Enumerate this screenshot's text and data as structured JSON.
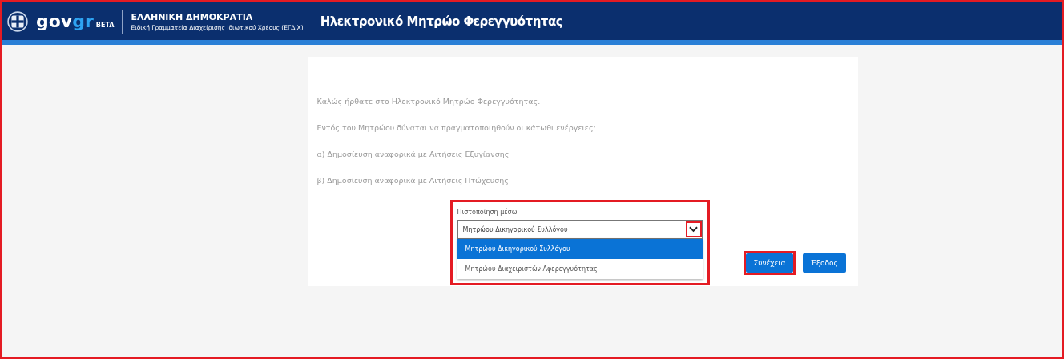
{
  "window": {
    "highlighted": true
  },
  "header": {
    "logo": "gov",
    "logo_accent": "gr",
    "logo_badge": "BETA",
    "org_title": "ΕΛΛΗΝΙΚΗ ΔΗΜΟΚΡΑΤΙΑ",
    "org_subtitle": "Ειδική Γραμματεία Διαχείρισης Ιδιωτικού Χρέους (ΕΓΔΙΧ)",
    "app_title": "Ηλεκτρονικό Μητρώο Φερεγγυότητας"
  },
  "intro": [
    "Καλώς ήρθατε στο Ηλεκτρονικό Μητρώο Φερεγγυότητας.",
    "Εντός του Μητρώου δύναται να πραγματοποιηθούν οι κάτωθι ενέργειες:",
    "α) Δημοσίευση αναφορικά με Αιτήσεις Εξυγίανσης",
    "β) Δημοσίευση αναφορικά με Αιτήσεις Πτώχευσης"
  ],
  "dropdown": {
    "label": "Πιστοποίηση μέσω",
    "value": "Μητρώου Δικηγορικού Συλλόγου",
    "expanded": true,
    "highlighted": true,
    "toggle_highlighted": true,
    "options": [
      {
        "label": "Μητρώου Δικηγορικού Συλλόγου",
        "selected": true
      },
      {
        "label": "Μητρώου Διαχειριστών Αφερεγγυότητας",
        "selected": false
      }
    ]
  },
  "buttons": [
    {
      "label": "Συνέχεια",
      "highlighted": true
    },
    {
      "label": "Έξοδος",
      "highlighted": false
    }
  ]
}
